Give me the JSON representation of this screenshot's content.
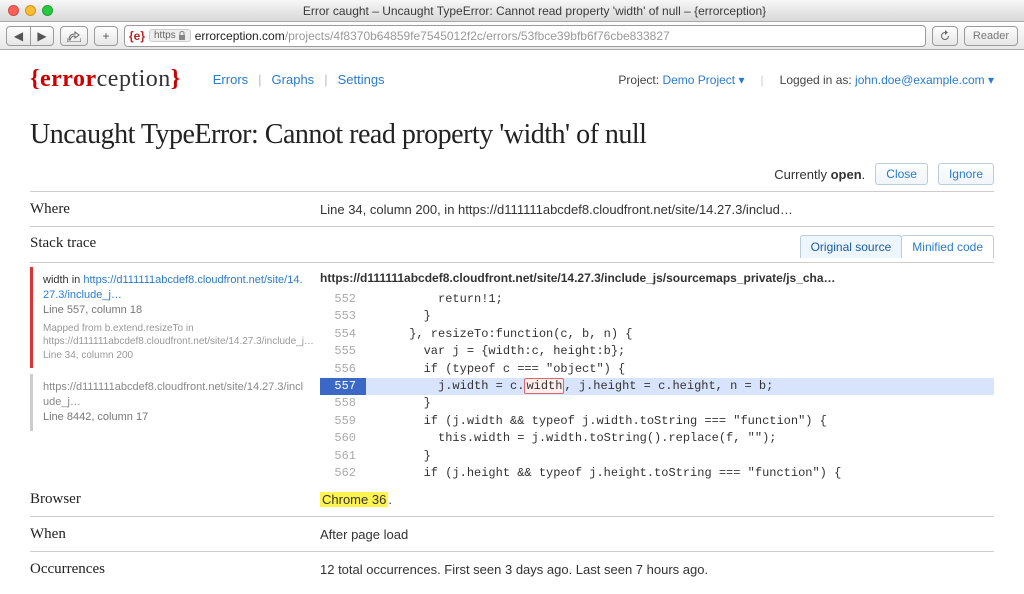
{
  "window": {
    "title": "Error caught – Uncaught TypeError: Cannot read property 'width' of null – {errorception}"
  },
  "url": {
    "scheme": "https",
    "host": "errorception.com",
    "path": "/projects/4f8370b64859fe7545012f2c/errors/53fbce39bfb6f76cbe833827",
    "reader": "Reader"
  },
  "brand": {
    "left": "error",
    "right": "ception"
  },
  "nav": {
    "errors": "Errors",
    "graphs": "Graphs",
    "settings": "Settings"
  },
  "rightnav": {
    "project_label": "Project:",
    "project_name": "Demo Project ▾",
    "login_label": "Logged in as:",
    "login_user": "john.doe@example.com ▾"
  },
  "error_title": "Uncaught TypeError: Cannot read property 'width' of null",
  "status": {
    "prefix": "Currently ",
    "state": "open",
    "suffix": ".",
    "close": "Close",
    "ignore": "Ignore"
  },
  "where": {
    "label": "Where",
    "value": "Line 34, column 200, in https://d111111abcdef8.cloudfront.net/site/14.27.3/includ…"
  },
  "stack": {
    "label": "Stack trace",
    "tab_original": "Original source",
    "tab_minified": "Minified code",
    "source_path": "https://d111111abcdef8.cloudfront.net/site/14.27.3/include_js/sourcemaps_private/js_cha…",
    "frames": [
      {
        "active": true,
        "title_pre": "width in ",
        "title_link": "https://d111111abcdef8.cloudfront.net/site/14.27.3/include_j…",
        "line": "Line 557, column 18",
        "mapped_pre": "Mapped from b.extend.resizeTo in ",
        "mapped_link": "https://d111111abcdef8.cloudfront.net/site/14.27.3/include_j…",
        "mapped_line": "Line 34, column 200"
      },
      {
        "active": false,
        "title_pre": "",
        "title_link": "https://d111111abcdef8.cloudfront.net/site/14.27.3/include_j…",
        "line": "Line 8442, column 17"
      }
    ],
    "code": [
      {
        "n": "552",
        "t": "          return!1;"
      },
      {
        "n": "553",
        "t": "        }"
      },
      {
        "n": "554",
        "t": "      }, resizeTo:function(c, b, n) {"
      },
      {
        "n": "555",
        "t": "        var j = {width:c, height:b};"
      },
      {
        "n": "556",
        "t": "        if (typeof c === \"object\") {"
      },
      {
        "n": "557",
        "t": "          j.width = c.",
        "hl": true,
        "err": "width",
        "t2": ", j.height = c.height, n = b;"
      },
      {
        "n": "558",
        "t": "        }"
      },
      {
        "n": "559",
        "t": "        if (j.width && typeof j.width.toString === \"function\") {"
      },
      {
        "n": "560",
        "t": "          this.width = j.width.toString().replace(f, \"\");"
      },
      {
        "n": "561",
        "t": "        }"
      },
      {
        "n": "562",
        "t": "        if (j.height && typeof j.height.toString === \"function\") {"
      }
    ]
  },
  "browser": {
    "label": "Browser",
    "value": "Chrome 36",
    "suffix": "."
  },
  "when": {
    "label": "When",
    "value": "After page load"
  },
  "occ": {
    "label": "Occurrences",
    "value": "12 total occurrences. First seen 3 days ago. Last seen 7 hours ago."
  }
}
